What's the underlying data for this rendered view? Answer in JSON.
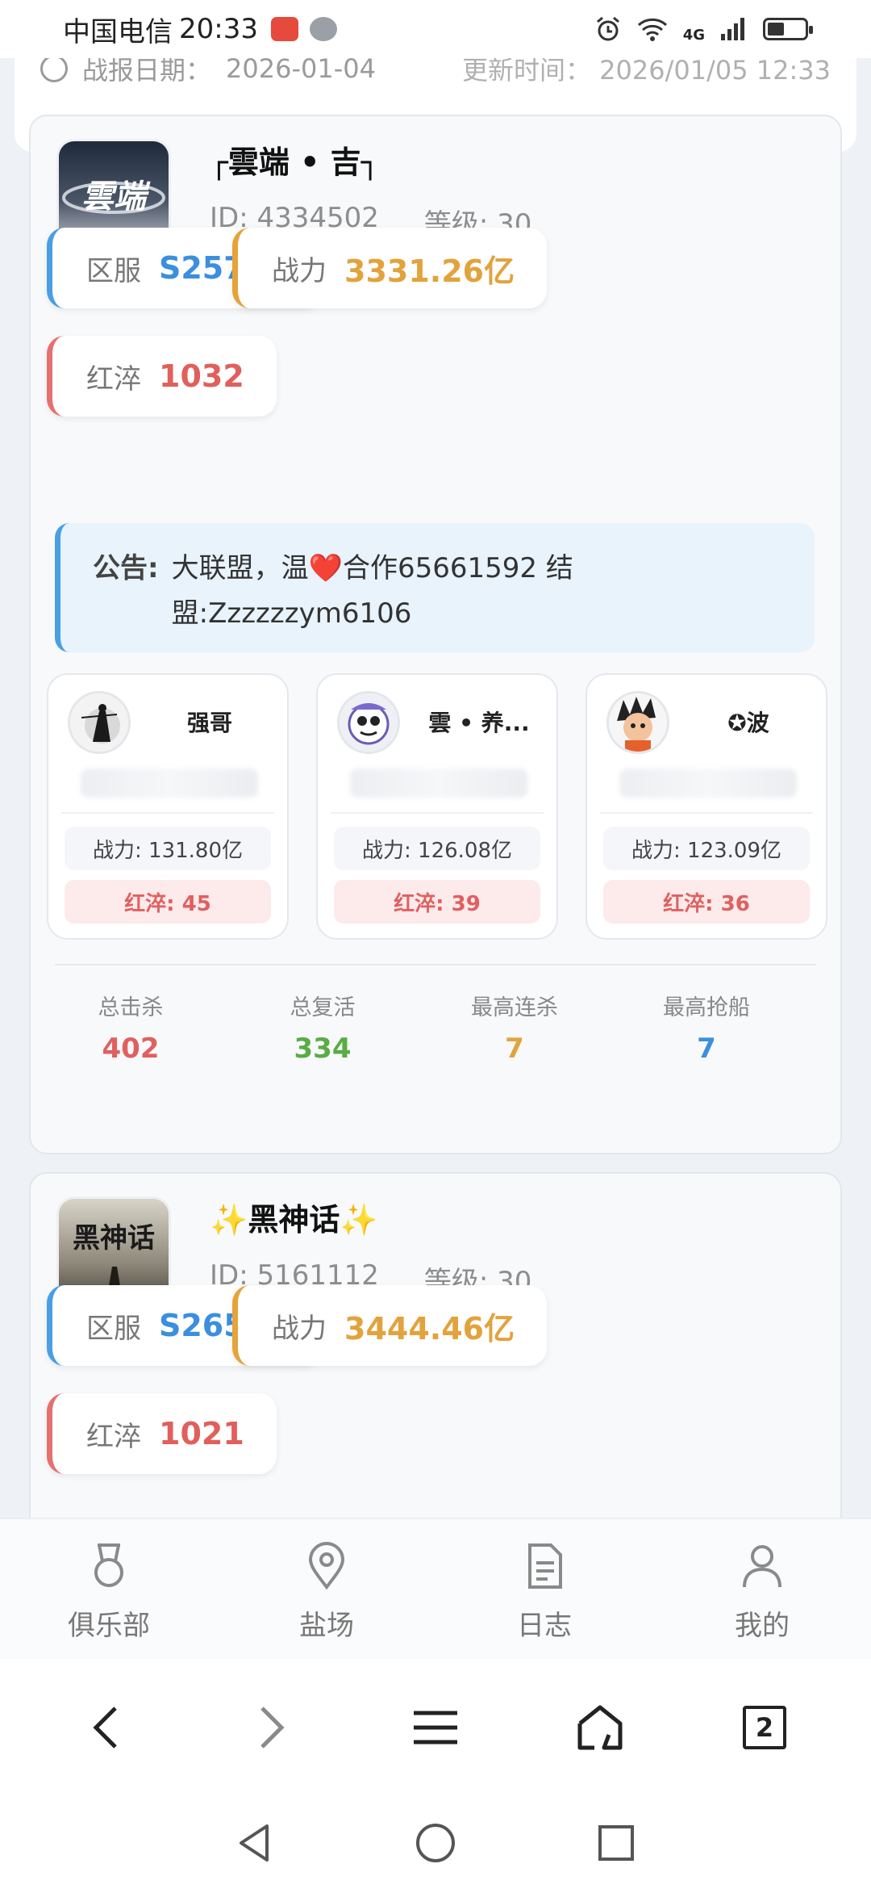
{
  "status_bar": {
    "carrier": "中国电信",
    "time": "20:33",
    "network": "4G"
  },
  "top_card": {
    "date_label": "战报日期：",
    "date_value": "2026-01-04",
    "update_label": "更新时间：",
    "update_value": "2026/01/05 12:33"
  },
  "clans": [
    {
      "name": "┌雲端 • 吉┐",
      "avatar_text": "雲端",
      "id_text": "ID: 4334502",
      "level_text": "等级: 30",
      "server_label": "区服",
      "server_value": "S25799",
      "power_label": "战力",
      "power_value": "3331.26亿",
      "red_label": "红淬",
      "red_value": "1032",
      "notice_label": "公告:",
      "notice_text_pre": "大联盟，温",
      "notice_heart": "❤️",
      "notice_text_post": "合作65661592 结盟:Zzzzzzym6106",
      "members": [
        {
          "name": "强哥",
          "power": "战力: 131.80亿",
          "red": "红淬: 45"
        },
        {
          "name": "雲 • 养...",
          "power": "战力: 126.08亿",
          "red": "红淬: 39"
        },
        {
          "name": "✪波",
          "power": "战力: 123.09亿",
          "red": "红淬: 36"
        }
      ],
      "stats": [
        {
          "label": "总击杀",
          "value": "402",
          "color": "#e06060"
        },
        {
          "label": "总复活",
          "value": "334",
          "color": "#5aac44"
        },
        {
          "label": "最高连杀",
          "value": "7",
          "color": "#e2a33d"
        },
        {
          "label": "最高抢船",
          "value": "7",
          "color": "#3b8fde"
        }
      ]
    },
    {
      "name": "✨黑神话✨",
      "avatar_text": "黑神话",
      "id_text": "ID: 5161112",
      "level_text": "等级: 30",
      "server_label": "区服",
      "server_value": "S26501",
      "power_label": "战力",
      "power_value": "3444.46亿",
      "red_label": "红淬",
      "red_value": "1021"
    }
  ],
  "tabs": [
    {
      "label": "俱乐部",
      "icon": "medal-icon"
    },
    {
      "label": "盐场",
      "icon": "location-pin-icon"
    },
    {
      "label": "日志",
      "icon": "document-icon"
    },
    {
      "label": "我的",
      "icon": "user-icon"
    }
  ],
  "browser": {
    "tab_count": "2"
  }
}
